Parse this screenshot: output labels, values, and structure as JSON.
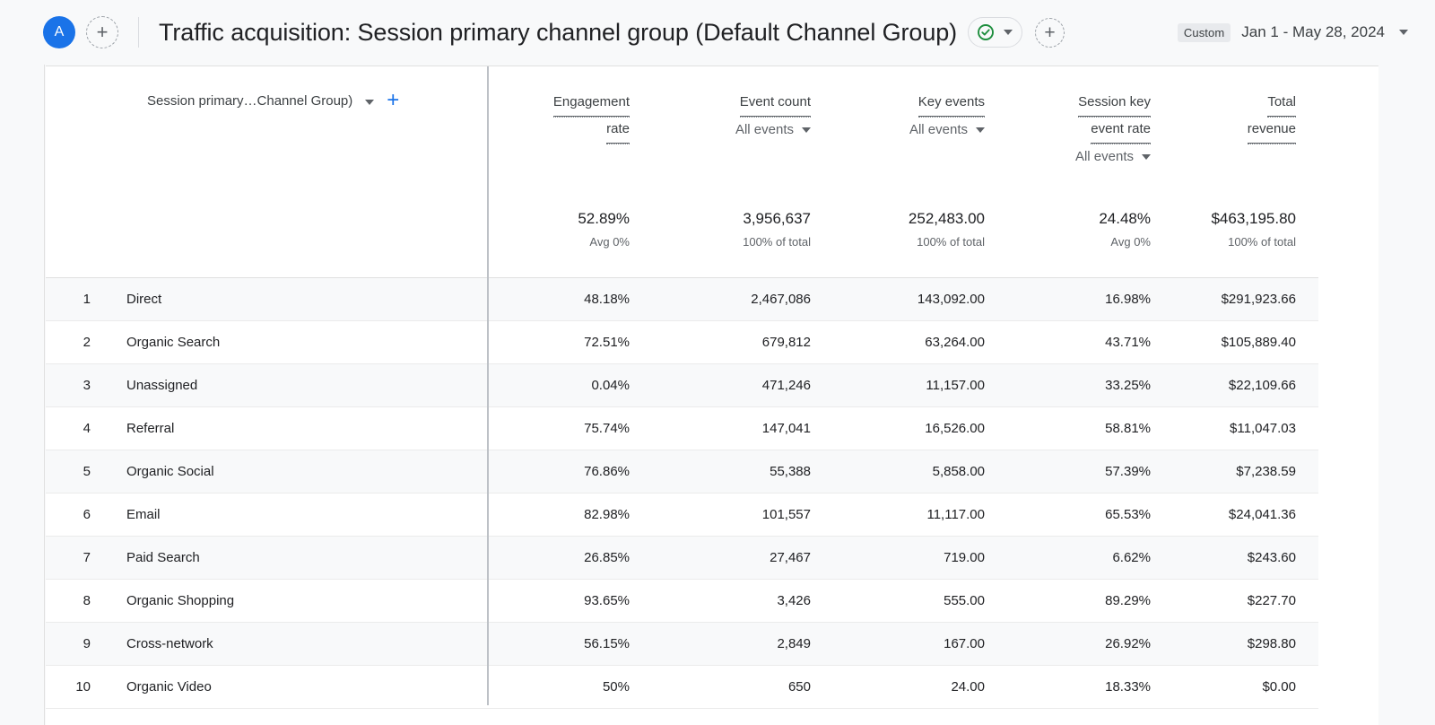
{
  "topbar": {
    "avatar_initial": "A",
    "add_property_icon": "plus-icon",
    "page_title": "Traffic acquisition: Session primary channel group (Default Channel Group)",
    "check_badge_icon": "check-circle-icon",
    "check_badge_caret_icon": "chevron-down-icon",
    "add_comparison_icon": "plus-icon",
    "date_badge": "Custom",
    "date_range": "Jan 1 - May 28, 2024",
    "date_caret_icon": "chevron-down-icon"
  },
  "table": {
    "dimension_header": {
      "label": "Session primary…Channel Group)",
      "caret_icon": "chevron-down-icon",
      "add_dimension_icon": "plus-icon"
    },
    "columns": [
      {
        "name_lines": [
          "Engagement",
          "rate"
        ],
        "filter": null
      },
      {
        "name_lines": [
          "Event count"
        ],
        "filter": "All events"
      },
      {
        "name_lines": [
          "Key events"
        ],
        "filter": "All events"
      },
      {
        "name_lines": [
          "Session key",
          "event rate"
        ],
        "filter": "All events"
      },
      {
        "name_lines": [
          "Total",
          "revenue"
        ],
        "filter": null
      }
    ],
    "summary": [
      {
        "value": "52.89%",
        "sub": "Avg 0%"
      },
      {
        "value": "3,956,637",
        "sub": "100% of total"
      },
      {
        "value": "252,483.00",
        "sub": "100% of total"
      },
      {
        "value": "24.48%",
        "sub": "Avg 0%"
      },
      {
        "value": "$463,195.80",
        "sub": "100% of total"
      }
    ],
    "rows": [
      {
        "index": "1",
        "name": "Direct",
        "values": [
          "48.18%",
          "2,467,086",
          "143,092.00",
          "16.98%",
          "$291,923.66"
        ]
      },
      {
        "index": "2",
        "name": "Organic Search",
        "values": [
          "72.51%",
          "679,812",
          "63,264.00",
          "43.71%",
          "$105,889.40"
        ]
      },
      {
        "index": "3",
        "name": "Unassigned",
        "values": [
          "0.04%",
          "471,246",
          "11,157.00",
          "33.25%",
          "$22,109.66"
        ]
      },
      {
        "index": "4",
        "name": "Referral",
        "values": [
          "75.74%",
          "147,041",
          "16,526.00",
          "58.81%",
          "$11,047.03"
        ]
      },
      {
        "index": "5",
        "name": "Organic Social",
        "values": [
          "76.86%",
          "55,388",
          "5,858.00",
          "57.39%",
          "$7,238.59"
        ]
      },
      {
        "index": "6",
        "name": "Email",
        "values": [
          "82.98%",
          "101,557",
          "11,117.00",
          "65.53%",
          "$24,041.36"
        ]
      },
      {
        "index": "7",
        "name": "Paid Search",
        "values": [
          "26.85%",
          "27,467",
          "719.00",
          "6.62%",
          "$243.60"
        ]
      },
      {
        "index": "8",
        "name": "Organic Shopping",
        "values": [
          "93.65%",
          "3,426",
          "555.00",
          "89.29%",
          "$227.70"
        ]
      },
      {
        "index": "9",
        "name": "Cross-network",
        "values": [
          "56.15%",
          "2,849",
          "167.00",
          "26.92%",
          "$298.80"
        ]
      },
      {
        "index": "10",
        "name": "Organic Video",
        "values": [
          "50%",
          "650",
          "24.00",
          "18.33%",
          "$0.00"
        ]
      }
    ]
  },
  "colors": {
    "accent_blue": "#1a73e8",
    "check_green": "#1e8e3e",
    "text_primary": "#202124",
    "text_secondary": "#5f6368",
    "row_stripe": "#f8f9fa"
  }
}
